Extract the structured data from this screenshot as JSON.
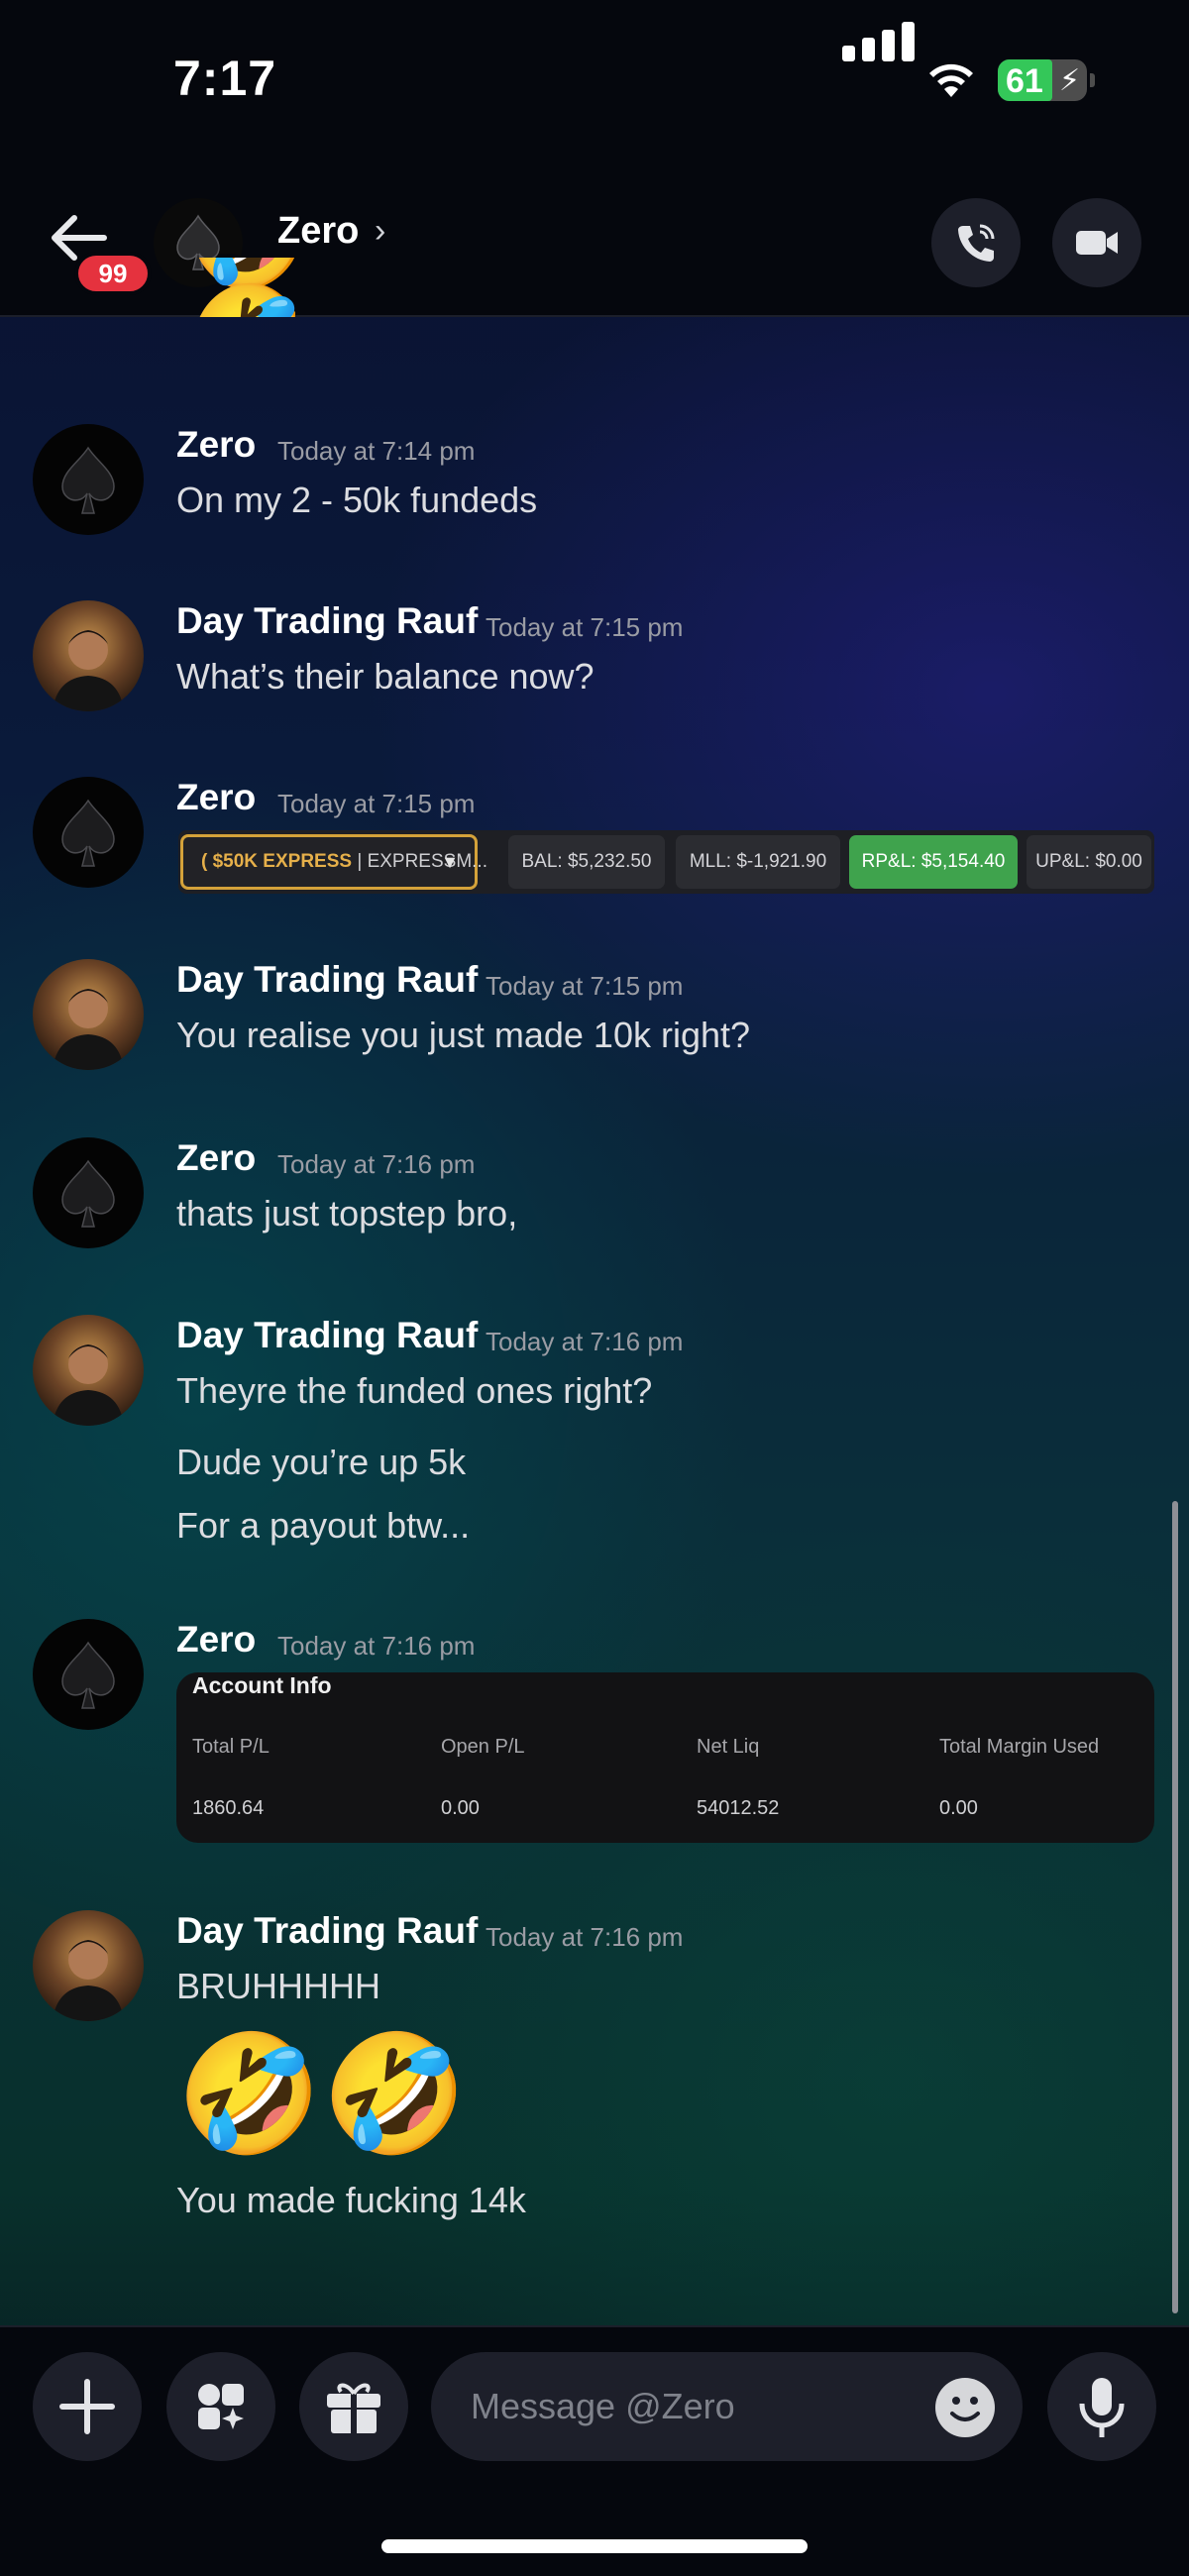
{
  "status_bar": {
    "time": "7:17",
    "battery": "61"
  },
  "header": {
    "unread_badge": "99",
    "contact_name": "Zero",
    "chevron": "›"
  },
  "colors": {
    "accent_red": "#e5323e",
    "idle_status": "#f0b232",
    "green_pill": "#3fa34d",
    "account_border": "#d4a23a"
  },
  "messages": [
    {
      "author": "Zero",
      "timestamp": "Today at 7:14 pm",
      "text": "On my 2 - 50k fundeds"
    },
    {
      "author": "Day Trading Rauf",
      "timestamp": "Today at 7:15 pm",
      "text": "What’s their balance now?"
    },
    {
      "author": "Zero",
      "timestamp": "Today at 7:15 pm",
      "stats_bar": {
        "account_prefix": "(",
        "account_label": "$50K EXPRESS",
        "account_rest": " | EXPRESSM...",
        "dropdown_arrow": "▼",
        "bal": "BAL: $5,232.50",
        "mll": "MLL: $-1,921.90",
        "rpl": "RP&L: $5,154.40",
        "upl": "UP&L: $0.00"
      }
    },
    {
      "author": "Day Trading Rauf",
      "timestamp": "Today at 7:15 pm",
      "text": "You realise you just made 10k right?"
    },
    {
      "author": "Zero",
      "timestamp": "Today at 7:16 pm",
      "text": "thats just topstep bro,"
    },
    {
      "author": "Day Trading Rauf",
      "timestamp": "Today at 7:16 pm",
      "text": "Theyre the funded ones right?",
      "followups": [
        "Dude you’re up 5k",
        "For a payout btw..."
      ]
    },
    {
      "author": "Zero",
      "timestamp": "Today at 7:16 pm",
      "account_info": {
        "title": "Account Info",
        "headers": [
          "Total P/L",
          "Open P/L",
          "Net Liq",
          "Total Margin Used"
        ],
        "values": [
          "1860.64",
          "0.00",
          "54012.52",
          "0.00"
        ]
      }
    },
    {
      "author": "Day Trading Rauf",
      "timestamp": "Today at 7:16 pm",
      "text": "BRUHHHHH",
      "emoji": "🤣🤣",
      "followups": [
        "You made fucking 14k"
      ]
    }
  ],
  "composer": {
    "placeholder": "Message @Zero"
  },
  "icons": [
    "back-arrow-icon",
    "phone-icon",
    "video-icon",
    "plus-icon",
    "apps-icon",
    "gift-icon",
    "emoji-icon",
    "microphone-icon",
    "spade-icon"
  ]
}
